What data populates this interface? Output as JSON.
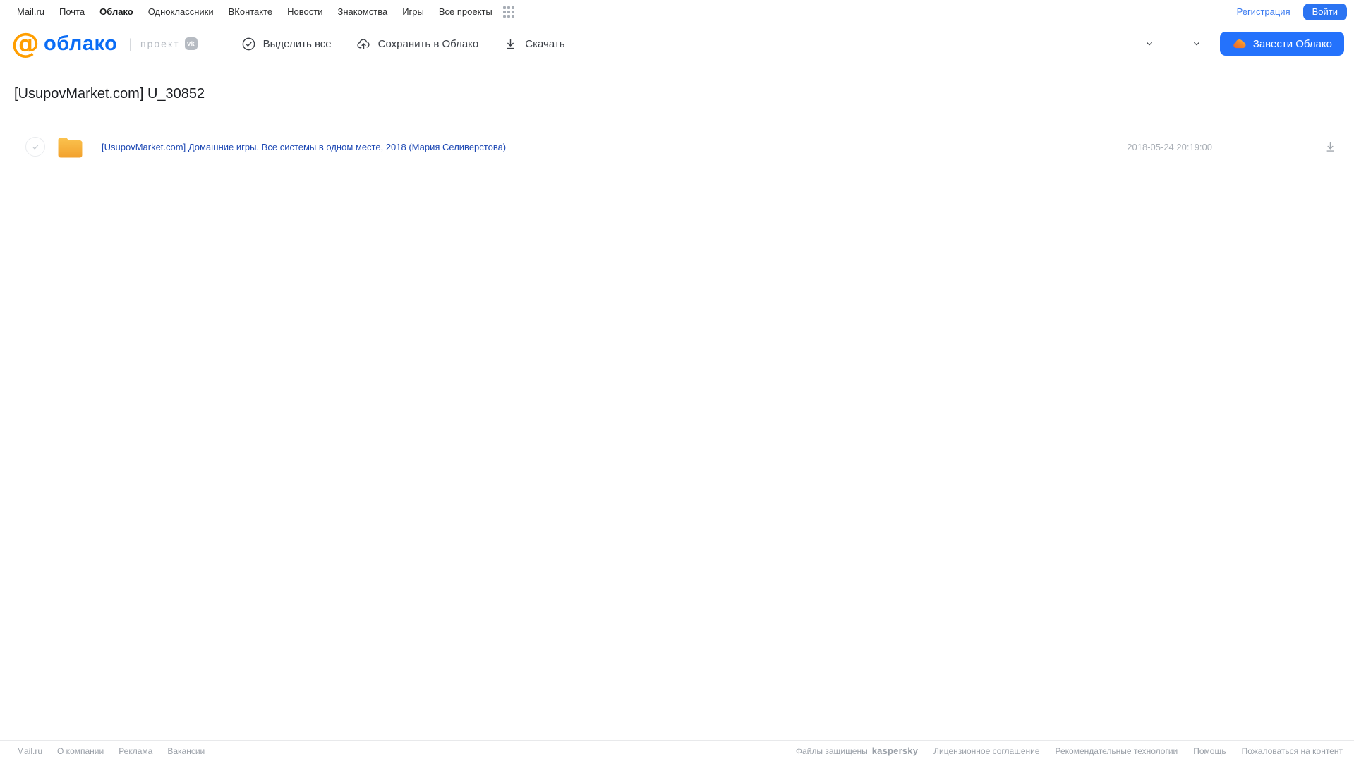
{
  "topnav": {
    "links": [
      {
        "label": "Mail.ru"
      },
      {
        "label": "Почта"
      },
      {
        "label": "Облако"
      },
      {
        "label": "Одноклассники"
      },
      {
        "label": "ВКонтакте"
      },
      {
        "label": "Новости"
      },
      {
        "label": "Знакомства"
      },
      {
        "label": "Игры"
      },
      {
        "label": "Все проекты"
      }
    ],
    "active_item": "Облако",
    "registration_label": "Регистрация",
    "login_label": "Войти"
  },
  "header": {
    "logo_at": "@",
    "logo_word": "облако",
    "project_label": "проект",
    "vk_badge": "vk",
    "toolbar": {
      "select_all_label": "Выделить все",
      "save_to_cloud_label": "Сохранить в Облако",
      "download_label": "Скачать"
    },
    "get_cloud_label": "Завести Облако"
  },
  "main": {
    "title": "[UsupovMarket.com] U_30852",
    "files": [
      {
        "type": "folder",
        "name": "[UsupovMarket.com] Домашние игры. Все системы в одном месте, 2018 (Мария Селиверстова)",
        "date": "2018-05-24 20:19:00"
      }
    ]
  },
  "footer": {
    "left_links": [
      {
        "label": "Mail.ru"
      },
      {
        "label": "О компании"
      },
      {
        "label": "Реклама"
      },
      {
        "label": "Вакансии"
      }
    ],
    "protected_label": "Файлы защищены",
    "kaspersky_label": "kaspersky",
    "right_links": [
      {
        "label": "Лицензионное соглашение"
      },
      {
        "label": "Рекомендательные технологии"
      },
      {
        "label": "Помощь"
      },
      {
        "label": "Пожаловаться на контент"
      }
    ]
  },
  "icons": {
    "grid": "all-projects-grid-icon",
    "select_all": "check-circle-icon",
    "save": "cloud-upload-icon",
    "download": "download-icon",
    "view": "view-mode-icon",
    "sort": "sort-icon",
    "chevron": "chevron-down-icon",
    "cloud": "cloud-icon",
    "folder": "folder-icon",
    "vk": "vk-icon"
  },
  "colors": {
    "accent_blue": "#2472fc",
    "logo_orange": "#ff9e00",
    "logo_blue": "#0a6cf5",
    "folder_orange": "#f2a12d",
    "file_link_blue": "#1e49b4",
    "muted_gray": "#9aa0a8",
    "kaspersky_green": "#00816a"
  }
}
